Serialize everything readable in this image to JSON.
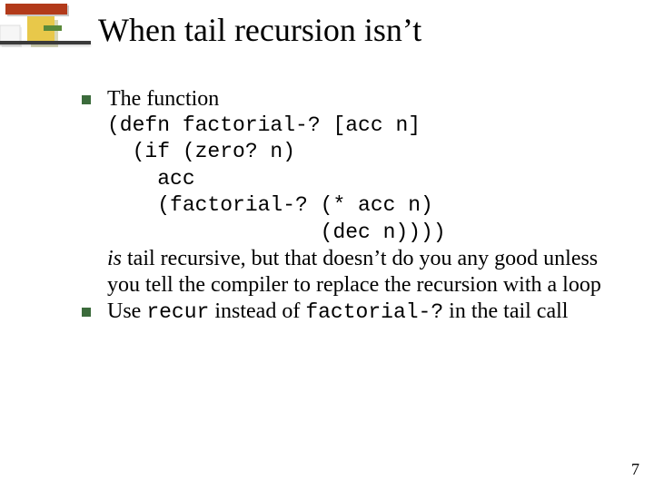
{
  "title": "When tail recursion isn’t",
  "items": [
    {
      "intro": "The function",
      "code": [
        "(defn factorial-? [acc n]",
        "  (if (zero? n)",
        "    acc",
        "    (factorial-? (* acc n)",
        "                 (dec n))))"
      ],
      "after_emph": "is",
      "after_text": " tail recursive, but that doesn’t do you any good unless you tell the compiler to replace the recursion with a loop"
    },
    {
      "parts": [
        "Use ",
        "recur",
        " instead of ",
        "factorial-?",
        " in the tail call"
      ]
    }
  ],
  "page_number": "7"
}
